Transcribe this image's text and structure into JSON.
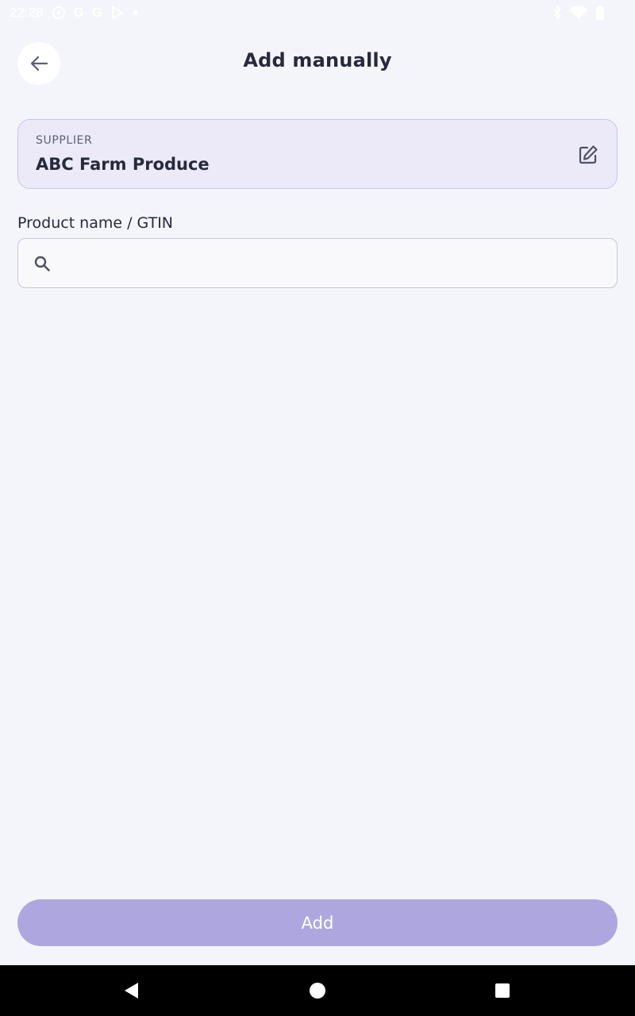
{
  "status_bar": {
    "time": "22:28",
    "notification_glyphs": [
      "G",
      "G"
    ]
  },
  "header": {
    "title": "Add manually"
  },
  "supplier": {
    "caption": "SUPPLIER",
    "name": "ABC Farm Produce"
  },
  "product_field": {
    "label": "Product name / GTIN",
    "value": "",
    "placeholder": ""
  },
  "actions": {
    "add_label": "Add"
  },
  "icons": {
    "back": "arrow-left-icon",
    "edit": "edit-icon",
    "search": "search-icon"
  },
  "colors": {
    "background": "#f4f5fa",
    "accent": "#aea7df",
    "card_background": "#eceaf8",
    "text_primary": "#272a3d"
  }
}
